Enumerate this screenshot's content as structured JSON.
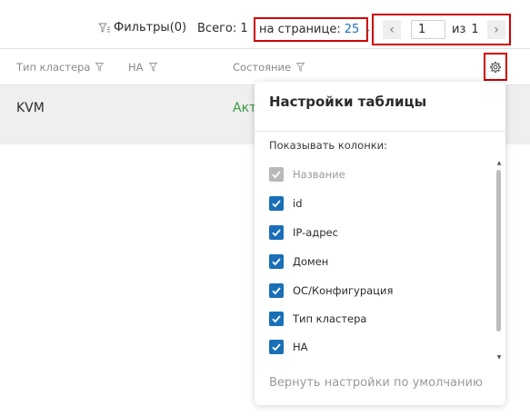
{
  "toolbar": {
    "filters_label": "Фильтры(0)",
    "total_label": "Всего: 1",
    "per_page_label": "на странице:",
    "per_page_value": "25",
    "page_current": "1",
    "page_of_label": "из",
    "page_total": "1"
  },
  "table": {
    "columns": [
      {
        "label": "Тип кластера"
      },
      {
        "label": "НА"
      },
      {
        "label": "Состояние"
      }
    ],
    "rows": [
      {
        "type": "KVM",
        "state": "Акт"
      }
    ]
  },
  "settings": {
    "title": "Настройки таблицы",
    "subtitle": "Показывать колонки:",
    "options": [
      {
        "label": "Название",
        "checked": true,
        "disabled": true
      },
      {
        "label": "id",
        "checked": true,
        "disabled": false
      },
      {
        "label": "IP-адрес",
        "checked": true,
        "disabled": false
      },
      {
        "label": "Домен",
        "checked": true,
        "disabled": false
      },
      {
        "label": "ОС/Конфигурация",
        "checked": true,
        "disabled": false
      },
      {
        "label": "Тип кластера",
        "checked": true,
        "disabled": false
      },
      {
        "label": "НА",
        "checked": true,
        "disabled": false
      }
    ],
    "reset_label": "Вернуть настройки по умолчанию"
  },
  "colors": {
    "accent": "#1a6fb8",
    "highlight_border": "#d00000",
    "status_active": "#3a9a3e",
    "row_bg": "#efefef"
  },
  "icons": {
    "filters": "funnel-icon",
    "per_page_dropdown": "chevron-down-icon",
    "prev_page": "chevron-left-icon",
    "next_page": "chevron-right-icon",
    "column_filter": "funnel-icon",
    "settings": "gear-icon",
    "checkbox": "check-icon"
  }
}
